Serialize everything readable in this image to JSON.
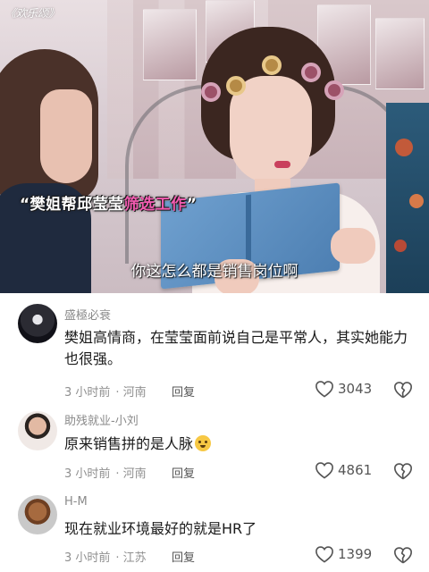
{
  "video": {
    "watermark": "《欢乐颂》",
    "headline_prefix": "“樊姐帮邱莹莹",
    "headline_highlight": "筛选工作",
    "headline_suffix": "”",
    "subtitle": "你这怎么都是销售岗位啊",
    "headline_highlight_color": "#f25bb0"
  },
  "comments": [
    {
      "username": "盛極必衰",
      "text": "樊姐高情商，在莹莹面前说自己是平常人，其实她能力也很强。",
      "time": "3 小时前",
      "location": "· 河南",
      "reply_label": "回复",
      "likes": "3043",
      "avatar_icon": "dark-character-avatar"
    },
    {
      "username": "助残就业-小刘",
      "text": "原来销售拼的是人脉",
      "emoji": "crying-laughing-emoji",
      "time": "3 小时前",
      "location": "· 河南",
      "reply_label": "回复",
      "likes": "4861",
      "avatar_icon": "person-photo-avatar"
    },
    {
      "username": "H-M",
      "text": "现在就业环境最好的就是HR了",
      "time": "3 小时前",
      "location": "· 江苏",
      "reply_label": "回复",
      "likes": "1399",
      "avatar_icon": "monkey-avatar"
    }
  ],
  "colors": {
    "username": "#8a8a8a",
    "meta": "#8f8f8f",
    "text": "#1a1a1a"
  }
}
